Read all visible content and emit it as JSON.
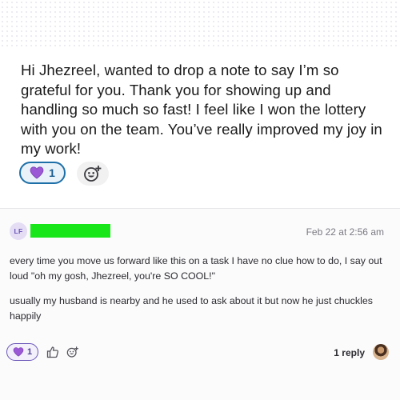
{
  "post": {
    "message": "Hi Jhezreel, wanted to drop a note to say I’m so grateful for you. Thank you for showing up and handling so much so fast! I feel like I won the lottery with you on the team. You’ve really improved my joy in my work!",
    "reactions": [
      {
        "icon": "purple-heart-icon",
        "count": "1"
      }
    ],
    "add_reaction_icon": "add-emoji-icon"
  },
  "reply": {
    "author_initials": "LF",
    "author_name": "",
    "timestamp": "Feb 22 at 2:56 am",
    "paragraphs": [
      "every time you move us forward like this on a task I have no clue how to do, I say out loud \"oh my gosh, Jhezreel, you're SO COOL!\"",
      "usually my husband is nearby and he used to ask about it but now he just chuckles happily"
    ],
    "reactions": [
      {
        "icon": "purple-heart-icon",
        "count": "1"
      }
    ],
    "reply_count_label": "1 reply"
  },
  "colors": {
    "accent_blue": "#1d6fa8",
    "heart_purple": "#9b59d6",
    "redaction_green": "#19e619",
    "avatar_purple": "#6a55b8"
  }
}
